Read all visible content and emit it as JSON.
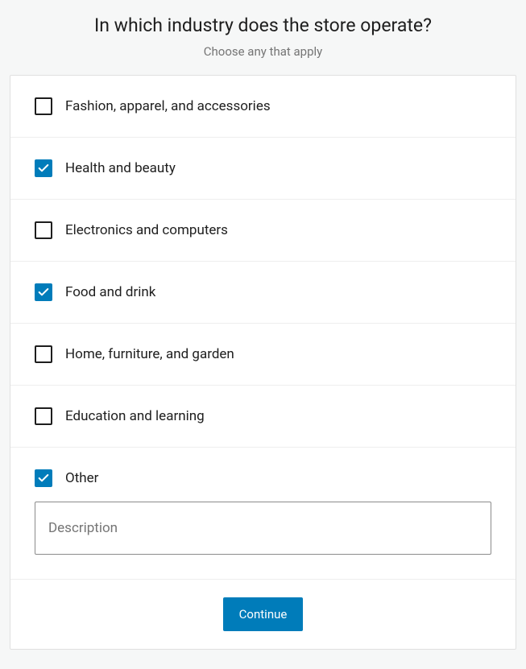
{
  "header": {
    "title": "In which industry does the store operate?",
    "subtitle": "Choose any that apply"
  },
  "options": [
    {
      "label": "Fashion, apparel, and accessories",
      "checked": false
    },
    {
      "label": "Health and beauty",
      "checked": true
    },
    {
      "label": "Electronics and computers",
      "checked": false
    },
    {
      "label": "Food and drink",
      "checked": true
    },
    {
      "label": "Home, furniture, and garden",
      "checked": false
    },
    {
      "label": "Education and learning",
      "checked": false
    },
    {
      "label": "Other",
      "checked": true
    }
  ],
  "description": {
    "placeholder": "Description",
    "value": ""
  },
  "footer": {
    "continue_label": "Continue"
  }
}
